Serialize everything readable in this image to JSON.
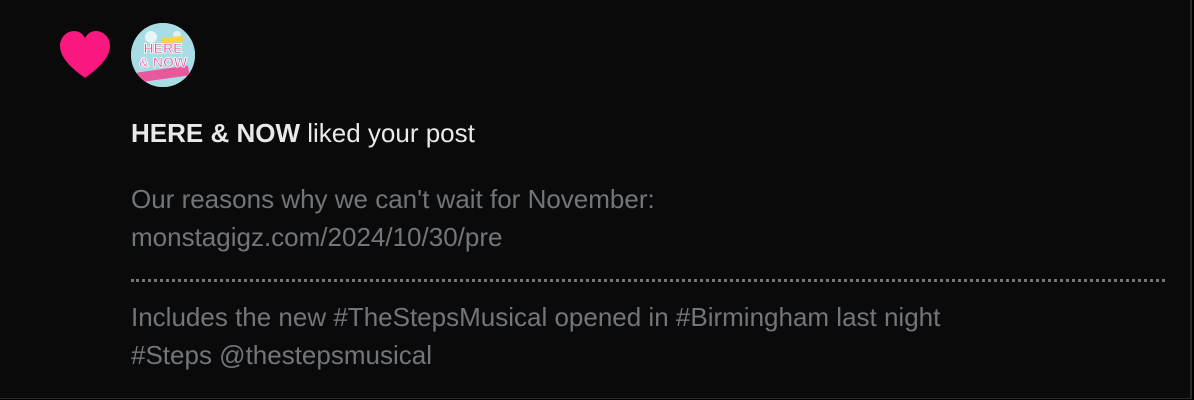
{
  "notification": {
    "icon": "heart-icon",
    "icon_color": "#f91880",
    "actor": "HERE & NOW",
    "action": " liked your post",
    "avatar": {
      "logo_line1": "HERE",
      "logo_line2": "& NOW"
    }
  },
  "post": {
    "line1": "Our reasons why we can't wait for November:",
    "line2": "monstagigz.com/2024/10/30/pre",
    "line3": "Includes the new #TheStepsMusical opened in #Birmingham last night",
    "line4": "#Steps @thestepsmusical"
  },
  "colors": {
    "background": "#0a0a0a",
    "primary_text": "#e7e9ea",
    "secondary_text": "#71767b"
  }
}
